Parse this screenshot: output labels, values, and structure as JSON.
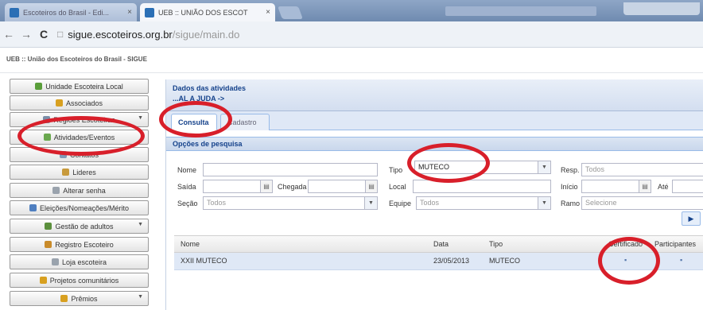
{
  "browser": {
    "tabs": [
      {
        "title": "Escoteiros do Brasil - Edi...",
        "close": "×"
      },
      {
        "title": "UEB :: UNIÃO DOS ESCOT",
        "close": "×"
      }
    ],
    "nav": {
      "back": "←",
      "forward": "→",
      "reload": "C",
      "url_domain": "sigue.escoteiros.org.br",
      "url_path": "/sigue/main.do"
    }
  },
  "app": {
    "header": "UEB :: União dos Escoteiros do Brasil - SIGUE"
  },
  "sidebar": {
    "items": [
      {
        "label": "Unidade Escoteira Local",
        "icon_color": "#5a9e3a",
        "has_arrow": false
      },
      {
        "label": "Associados",
        "icon_color": "#d8a020",
        "has_arrow": false
      },
      {
        "label": "Regiões Escoteiras",
        "icon_color": "#7a8ea8",
        "has_arrow": true,
        "arrow": "▼"
      },
      {
        "label": "Atividades/Eventos",
        "icon_color": "#6aa84f",
        "has_arrow": false
      },
      {
        "label": "Contatos",
        "icon_color": "#7f9ab8",
        "has_arrow": false
      },
      {
        "label": "Lideres",
        "icon_color": "#c89a3c",
        "has_arrow": false
      },
      {
        "label": "Alterar senha",
        "icon_color": "#9aa3ad",
        "has_arrow": false
      },
      {
        "label": "Eleições/Nomeações/Mérito",
        "icon_color": "#4f7fc0",
        "has_arrow": false
      },
      {
        "label": "Gestão de adultos",
        "icon_color": "#5b8f3c",
        "has_arrow": true,
        "arrow": "▼"
      },
      {
        "label": "Registro Escoteiro",
        "icon_color": "#c98b2a",
        "has_arrow": false
      },
      {
        "label": "Loja escoteira",
        "icon_color": "#9aa3ad",
        "has_arrow": false
      },
      {
        "label": "Projetos comunitários",
        "icon_color": "#d8a020",
        "has_arrow": false
      },
      {
        "label": "Prêmios",
        "icon_color": "#d8a020",
        "has_arrow": true,
        "arrow": "▼"
      }
    ]
  },
  "panel": {
    "title": "Dados das atividades",
    "breadcrumb": "...AL A JUDA ->",
    "tabs": {
      "active": "Consulta",
      "inactive": "Cadastro"
    },
    "filter_title": "Opções de pesquisa",
    "fields": {
      "nome": {
        "label": "Nome",
        "value": ""
      },
      "tipo": {
        "label": "Tipo",
        "value": "MUTECO"
      },
      "resp": {
        "label": "Resp.",
        "placeholder": "Todos"
      },
      "saida": {
        "label": "Saída",
        "value": ""
      },
      "chegada": {
        "label": "Chegada",
        "value": ""
      },
      "local": {
        "label": "Local",
        "value": ""
      },
      "inicio": {
        "label": "Início",
        "value": ""
      },
      "ate": {
        "label": "Até",
        "value": ""
      },
      "secao": {
        "label": "Seção",
        "placeholder": "Todos"
      },
      "equipe": {
        "label": "Equipe",
        "placeholder": "Todos"
      },
      "ramo": {
        "label": "Ramo",
        "placeholder": "Selecione"
      }
    },
    "search_button": "▶",
    "grid": {
      "columns": [
        "Nome",
        "Data",
        "Tipo",
        "Certificado",
        "Participantes"
      ],
      "rows": [
        {
          "nome": "XXII MUTECO",
          "data": "23/05/2013",
          "tipo": "MUTECO",
          "certificado": "▪ ",
          "participantes": "▪ "
        }
      ]
    }
  },
  "colors": {
    "annotation_red": "#d81f2a",
    "panel_blue": "#15428b"
  }
}
